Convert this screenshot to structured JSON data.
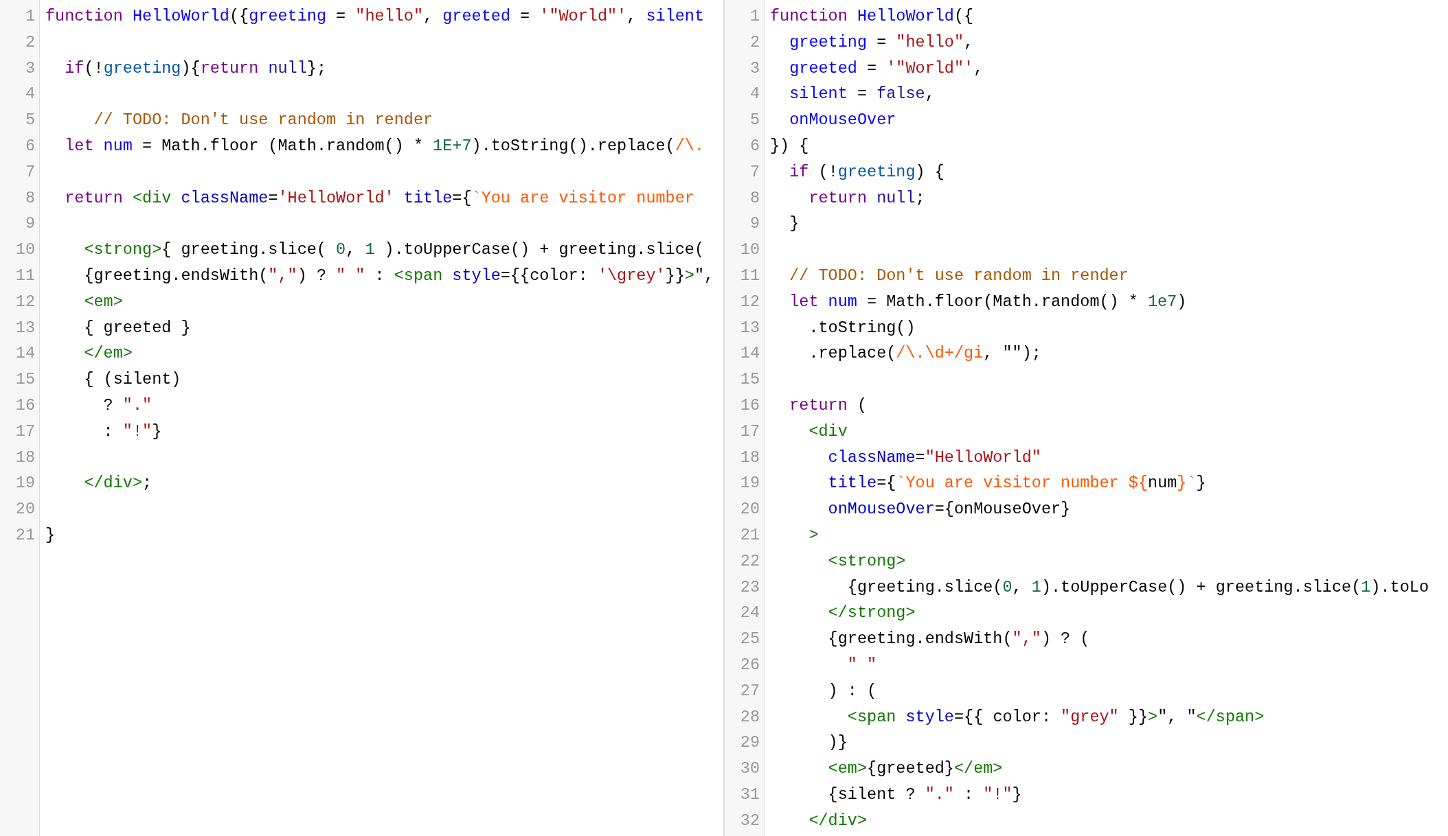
{
  "panes": [
    {
      "lines": [
        {
          "number": "1",
          "tokens": [
            {
              "kind": "kw",
              "text": "function"
            },
            {
              "kind": "def",
              "text": " HelloWorld"
            },
            {
              "kind": "plain",
              "text": "({"
            },
            {
              "kind": "def",
              "text": "greeting"
            },
            {
              "kind": "plain",
              "text": " = "
            },
            {
              "kind": "str",
              "text": "\"hello\""
            },
            {
              "kind": "plain",
              "text": ", "
            },
            {
              "kind": "def",
              "text": "greeted"
            },
            {
              "kind": "plain",
              "text": " = "
            },
            {
              "kind": "str",
              "text": "'\"World\"'"
            },
            {
              "kind": "plain",
              "text": ", "
            },
            {
              "kind": "def",
              "text": "silent"
            }
          ]
        },
        {
          "number": "2"
        },
        {
          "number": "3",
          "tokens": [
            {
              "kind": "kw",
              "text": "  if"
            },
            {
              "kind": "plain",
              "text": "(!"
            },
            {
              "kind": "var",
              "text": "greeting"
            },
            {
              "kind": "plain",
              "text": "){"
            },
            {
              "kind": "kw",
              "text": "return"
            },
            {
              "kind": "atom",
              "text": " null"
            },
            {
              "kind": "plain",
              "text": "};"
            }
          ]
        },
        {
          "number": "4"
        },
        {
          "number": "5",
          "tokens": [
            {
              "kind": "com",
              "text": "     // TODO: Don't use random in render"
            }
          ]
        },
        {
          "number": "6",
          "tokens": [
            {
              "kind": "kw",
              "text": "  let"
            },
            {
              "kind": "def",
              "text": " num"
            },
            {
              "kind": "plain",
              "text": " = Math.floor (Math.random() * "
            },
            {
              "kind": "num",
              "text": "1E+7"
            },
            {
              "kind": "plain",
              "text": ").toString().replace("
            },
            {
              "kind": "tmpl",
              "text": "/\\."
            }
          ]
        },
        {
          "number": "7"
        },
        {
          "number": "8",
          "tokens": [
            {
              "kind": "kw",
              "text": "  return"
            },
            {
              "kind": "tag",
              "text": " <div"
            },
            {
              "kind": "attr",
              "text": " className"
            },
            {
              "kind": "plain",
              "text": "="
            },
            {
              "kind": "str",
              "text": "'HelloWorld'"
            },
            {
              "kind": "attr",
              "text": " title"
            },
            {
              "kind": "plain",
              "text": "={"
            },
            {
              "kind": "tmpl",
              "text": "`You are visitor number"
            }
          ]
        },
        {
          "number": "9"
        },
        {
          "number": "10",
          "tokens": [
            {
              "kind": "tag",
              "text": "    <strong>"
            },
            {
              "kind": "plain",
              "text": "{ greeting.slice( "
            },
            {
              "kind": "num",
              "text": "0"
            },
            {
              "kind": "plain",
              "text": ", "
            },
            {
              "kind": "num",
              "text": "1"
            },
            {
              "kind": "plain",
              "text": " ).toUpperCase() + greeting.slice("
            }
          ]
        },
        {
          "number": "11",
          "tokens": [
            {
              "kind": "plain",
              "text": "    {greeting.endsWith("
            },
            {
              "kind": "str",
              "text": "\",\""
            },
            {
              "kind": "plain",
              "text": ") ? "
            },
            {
              "kind": "str",
              "text": "\" \""
            },
            {
              "kind": "plain",
              "text": " : "
            },
            {
              "kind": "tag",
              "text": "<span"
            },
            {
              "kind": "attr",
              "text": " style"
            },
            {
              "kind": "plain",
              "text": "={{color: "
            },
            {
              "kind": "str",
              "text": "'\\grey'"
            },
            {
              "kind": "plain",
              "text": "}}"
            },
            {
              "kind": "tag",
              "text": ">"
            },
            {
              "kind": "plain",
              "text": "\","
            }
          ]
        },
        {
          "number": "12",
          "tokens": [
            {
              "kind": "tag",
              "text": "    <em>"
            }
          ]
        },
        {
          "number": "13",
          "tokens": [
            {
              "kind": "plain",
              "text": "    { greeted }"
            }
          ]
        },
        {
          "number": "14",
          "tokens": [
            {
              "kind": "tag",
              "text": "    </em>"
            }
          ]
        },
        {
          "number": "15",
          "tokens": [
            {
              "kind": "plain",
              "text": "    { (silent)"
            }
          ]
        },
        {
          "number": "16",
          "tokens": [
            {
              "kind": "plain",
              "text": "      ? "
            },
            {
              "kind": "str",
              "text": "\".\""
            }
          ]
        },
        {
          "number": "17",
          "tokens": [
            {
              "kind": "plain",
              "text": "      : "
            },
            {
              "kind": "str",
              "text": "\"!\""
            },
            {
              "kind": "plain",
              "text": "}"
            }
          ]
        },
        {
          "number": "18"
        },
        {
          "number": "19",
          "tokens": [
            {
              "kind": "tag",
              "text": "    </div>"
            },
            {
              "kind": "plain",
              "text": ";"
            }
          ]
        },
        {
          "number": "20"
        },
        {
          "number": "21",
          "tokens": [
            {
              "kind": "plain",
              "text": "}"
            }
          ]
        }
      ]
    },
    {
      "lines": [
        {
          "number": "1",
          "tokens": [
            {
              "kind": "kw",
              "text": "function"
            },
            {
              "kind": "def",
              "text": " HelloWorld"
            },
            {
              "kind": "plain",
              "text": "({"
            }
          ]
        },
        {
          "number": "2",
          "tokens": [
            {
              "kind": "def",
              "text": "  greeting"
            },
            {
              "kind": "plain",
              "text": " = "
            },
            {
              "kind": "str",
              "text": "\"hello\""
            },
            {
              "kind": "plain",
              "text": ","
            }
          ]
        },
        {
          "number": "3",
          "tokens": [
            {
              "kind": "def",
              "text": "  greeted"
            },
            {
              "kind": "plain",
              "text": " = "
            },
            {
              "kind": "str",
              "text": "'\"World\"'"
            },
            {
              "kind": "plain",
              "text": ","
            }
          ]
        },
        {
          "number": "4",
          "tokens": [
            {
              "kind": "def",
              "text": "  silent"
            },
            {
              "kind": "plain",
              "text": " = "
            },
            {
              "kind": "atom",
              "text": "false"
            },
            {
              "kind": "plain",
              "text": ","
            }
          ]
        },
        {
          "number": "5",
          "tokens": [
            {
              "kind": "def",
              "text": "  onMouseOver"
            }
          ]
        },
        {
          "number": "6",
          "tokens": [
            {
              "kind": "plain",
              "text": "}) {"
            }
          ]
        },
        {
          "number": "7",
          "tokens": [
            {
              "kind": "kw",
              "text": "  if"
            },
            {
              "kind": "plain",
              "text": " (!"
            },
            {
              "kind": "var",
              "text": "greeting"
            },
            {
              "kind": "plain",
              "text": ") {"
            }
          ]
        },
        {
          "number": "8",
          "tokens": [
            {
              "kind": "kw",
              "text": "    return"
            },
            {
              "kind": "atom",
              "text": " null"
            },
            {
              "kind": "plain",
              "text": ";"
            }
          ]
        },
        {
          "number": "9",
          "tokens": [
            {
              "kind": "plain",
              "text": "  }"
            }
          ]
        },
        {
          "number": "10"
        },
        {
          "number": "11",
          "tokens": [
            {
              "kind": "com",
              "text": "  // TODO: Don't use random in render"
            }
          ]
        },
        {
          "number": "12",
          "tokens": [
            {
              "kind": "kw",
              "text": "  let"
            },
            {
              "kind": "def",
              "text": " num"
            },
            {
              "kind": "plain",
              "text": " = Math.floor(Math.random() * "
            },
            {
              "kind": "num",
              "text": "1e7"
            },
            {
              "kind": "plain",
              "text": ")"
            }
          ]
        },
        {
          "number": "13",
          "tokens": [
            {
              "kind": "plain",
              "text": "    .toString()"
            }
          ]
        },
        {
          "number": "14",
          "tokens": [
            {
              "kind": "plain",
              "text": "    .replace("
            },
            {
              "kind": "tmpl",
              "text": "/\\.\\d+/gi"
            },
            {
              "kind": "plain",
              "text": ", \"\");"
            }
          ]
        },
        {
          "number": "15"
        },
        {
          "number": "16",
          "tokens": [
            {
              "kind": "kw",
              "text": "  return"
            },
            {
              "kind": "plain",
              "text": " ("
            }
          ]
        },
        {
          "number": "17",
          "tokens": [
            {
              "kind": "tag",
              "text": "    <div"
            }
          ]
        },
        {
          "number": "18",
          "tokens": [
            {
              "kind": "attr",
              "text": "      className"
            },
            {
              "kind": "plain",
              "text": "="
            },
            {
              "kind": "str",
              "text": "\"HelloWorld\""
            }
          ]
        },
        {
          "number": "19",
          "tokens": [
            {
              "kind": "attr",
              "text": "      title"
            },
            {
              "kind": "plain",
              "text": "={"
            },
            {
              "kind": "tmpl",
              "text": "`You are visitor number ${"
            },
            {
              "kind": "plain",
              "text": "num"
            },
            {
              "kind": "tmpl",
              "text": "}`"
            },
            {
              "kind": "plain",
              "text": "}"
            }
          ]
        },
        {
          "number": "20",
          "tokens": [
            {
              "kind": "attr",
              "text": "      onMouseOver"
            },
            {
              "kind": "plain",
              "text": "={onMouseOver}"
            }
          ]
        },
        {
          "number": "21",
          "tokens": [
            {
              "kind": "tag",
              "text": "    >"
            }
          ]
        },
        {
          "number": "22",
          "tokens": [
            {
              "kind": "tag",
              "text": "      <strong>"
            }
          ]
        },
        {
          "number": "23",
          "tokens": [
            {
              "kind": "plain",
              "text": "        {greeting.slice("
            },
            {
              "kind": "num",
              "text": "0"
            },
            {
              "kind": "plain",
              "text": ", "
            },
            {
              "kind": "num",
              "text": "1"
            },
            {
              "kind": "plain",
              "text": ").toUpperCase() + greeting.slice("
            },
            {
              "kind": "num",
              "text": "1"
            },
            {
              "kind": "plain",
              "text": ").toLo"
            }
          ]
        },
        {
          "number": "24",
          "tokens": [
            {
              "kind": "tag",
              "text": "      </strong>"
            }
          ]
        },
        {
          "number": "25",
          "tokens": [
            {
              "kind": "plain",
              "text": "      {greeting.endsWith("
            },
            {
              "kind": "str",
              "text": "\",\""
            },
            {
              "kind": "plain",
              "text": ") ? ("
            }
          ]
        },
        {
          "number": "26",
          "tokens": [
            {
              "kind": "str",
              "text": "        \" \""
            }
          ]
        },
        {
          "number": "27",
          "tokens": [
            {
              "kind": "plain",
              "text": "      ) : ("
            }
          ]
        },
        {
          "number": "28",
          "tokens": [
            {
              "kind": "tag",
              "text": "        <span"
            },
            {
              "kind": "attr",
              "text": " style"
            },
            {
              "kind": "plain",
              "text": "={{ color: "
            },
            {
              "kind": "str",
              "text": "\"grey\""
            },
            {
              "kind": "plain",
              "text": " }}"
            },
            {
              "kind": "tag",
              "text": ">"
            },
            {
              "kind": "plain",
              "text": "\", \""
            },
            {
              "kind": "tag",
              "text": "</span>"
            }
          ]
        },
        {
          "number": "29",
          "tokens": [
            {
              "kind": "plain",
              "text": "      )}"
            }
          ]
        },
        {
          "number": "30",
          "tokens": [
            {
              "kind": "tag",
              "text": "      <em>"
            },
            {
              "kind": "plain",
              "text": "{greeted}"
            },
            {
              "kind": "tag",
              "text": "</em>"
            }
          ]
        },
        {
          "number": "31",
          "tokens": [
            {
              "kind": "plain",
              "text": "      {silent ? "
            },
            {
              "kind": "str",
              "text": "\".\""
            },
            {
              "kind": "plain",
              "text": " : "
            },
            {
              "kind": "str",
              "text": "\"!\""
            },
            {
              "kind": "plain",
              "text": "}"
            }
          ]
        },
        {
          "number": "32",
          "tokens": [
            {
              "kind": "tag",
              "text": "    </div>"
            }
          ]
        }
      ]
    }
  ]
}
